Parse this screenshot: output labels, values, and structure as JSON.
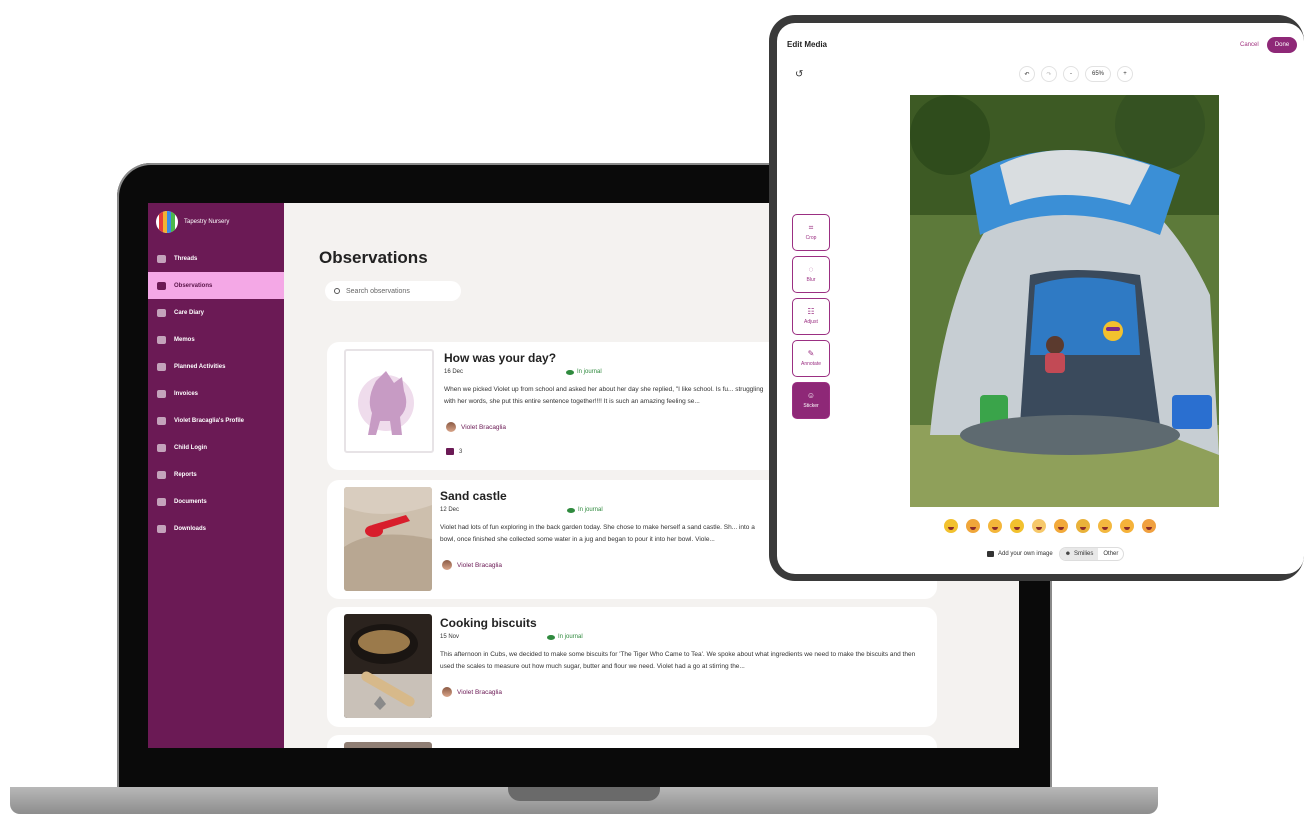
{
  "sidebar": {
    "org_name": "Tapestry Nursery",
    "items": [
      {
        "label": "Threads"
      },
      {
        "label": "Observations"
      },
      {
        "label": "Care Diary"
      },
      {
        "label": "Memos"
      },
      {
        "label": "Planned Activities"
      },
      {
        "label": "Invoices"
      },
      {
        "label": "Violet Bracaglia's Profile"
      },
      {
        "label": "Child Login"
      },
      {
        "label": "Reports"
      },
      {
        "label": "Documents"
      },
      {
        "label": "Downloads"
      }
    ],
    "active_index": 1
  },
  "main": {
    "title": "Observations",
    "search_placeholder": "Search observations",
    "observations": [
      {
        "title": "How was your day?",
        "date": "16 Dec",
        "status": "In journal",
        "text": "When we picked Violet up from school and asked her about her day she replied, \"I like school. Is fu... struggling with her words, she put this entire sentence together!!!! It is such an amazing feeling se...",
        "author": "Violet Bracaglia",
        "comments": "3"
      },
      {
        "title": "Sand castle",
        "date": "12 Dec",
        "status": "In journal",
        "text": "Violet had lots of fun exploring in the back garden today. She chose to make herself a sand castle. Sh... into a bowl, once finished she collected some water in a jug and began to pour it into her bowl. Viole...",
        "author": "Violet Bracaglia"
      },
      {
        "title": "Cooking biscuits",
        "date": "15 Nov",
        "status": "In journal",
        "text": "This afternoon in Cubs, we decided to make some biscuits for 'The Tiger Who Came to Tea'. We spoke about what ingredients we need to make the biscuits and then used the scales to measure out how much sugar, butter and flour we need. Violet had a go at stirring the...",
        "author": "Violet Bracaglia"
      }
    ]
  },
  "editor": {
    "title": "Edit Media",
    "cancel": "Cancel",
    "done": "Done",
    "zoom": "65%",
    "zoom_minus": "-",
    "zoom_plus": "+",
    "tools": [
      {
        "label": "Crop",
        "icon": "crop-icon"
      },
      {
        "label": "Blur",
        "icon": "blur-icon"
      },
      {
        "label": "Adjust",
        "icon": "adjust-icon"
      },
      {
        "label": "Annotate",
        "icon": "annotate-icon"
      },
      {
        "label": "Sticker",
        "icon": "sticker-icon"
      }
    ],
    "active_tool": "Sticker",
    "sticker_colors": [
      "#f2c12e",
      "#f0a63a",
      "#f4b63a",
      "#f2c12e",
      "#f6c86a",
      "#f2a93a",
      "#e9b23a",
      "#f3b83f",
      "#f5b23a",
      "#f0a040"
    ],
    "add_image": "Add your own image",
    "segments": [
      "Smilies",
      "Other"
    ],
    "active_segment": "Smilies"
  }
}
